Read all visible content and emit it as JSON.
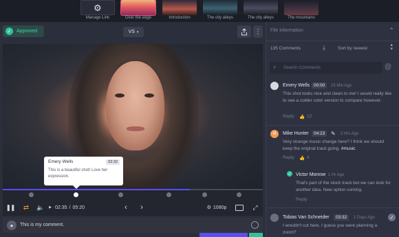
{
  "thumbnails": [
    {
      "label": "Manage Link",
      "kind": "gear-icon"
    },
    {
      "label": "Over the edge",
      "active": true,
      "color": "#e4505f"
    },
    {
      "label": "Introduction",
      "color": "#b5584a"
    },
    {
      "label": "The city alleys",
      "color": "#3f6172"
    },
    {
      "label": "The city alleys",
      "color": "#4a4d5e"
    },
    {
      "label": "The mountains",
      "color": "#3d3240"
    }
  ],
  "header": {
    "status_label": "Approved",
    "version_label": "VS",
    "share_icon": "share-icon",
    "more_icon": "more-vertical-icon"
  },
  "video_note": {
    "author": "Emery Wells",
    "timecode": "02:32",
    "text": "This is a beautiful shot! Love her expression."
  },
  "player": {
    "progress": 0.72,
    "current_time": "02:35",
    "separator": "/",
    "duration": "05:20",
    "quality": "1080p"
  },
  "composer": {
    "placeholder": "This is my comment."
  },
  "panel": {
    "title": "File information",
    "comment_count": "135 Comments",
    "sort_label": "Sort by newest",
    "search_placeholder": "Search Comments"
  },
  "comments": [
    {
      "author": "Emery Wells",
      "timecode": "00:00",
      "ago": "25 Min Ago",
      "body": "This shot looks nice and clean to me! I would really like to see a colder color version to compare however.",
      "reply": "Reply",
      "likes": "12"
    },
    {
      "author": "Mike Hunter",
      "timecode": "04:23",
      "ago": "2 Hrs Ago",
      "body_pre": "Very strange music change here? I think we should keep the original track going.",
      "hashtag": "#music",
      "reply": "Reply",
      "likes": "4",
      "avatar_initial": "M"
    },
    {
      "author": "Victor Monroe",
      "ago": "1 Hr Ago",
      "body": "That's part of the stock track but we can look for another song. Seems like a good idea.",
      "body_visible": "That's part of the stock track but we can look for another idea. New option coming.",
      "reply": "Reply"
    },
    {
      "author": "Tobias Van Schneider",
      "timecode": "03:32",
      "ago": "2 Days Ago",
      "body": "I wouldn't cut here. I guess you were planning a zoom?"
    }
  ]
}
